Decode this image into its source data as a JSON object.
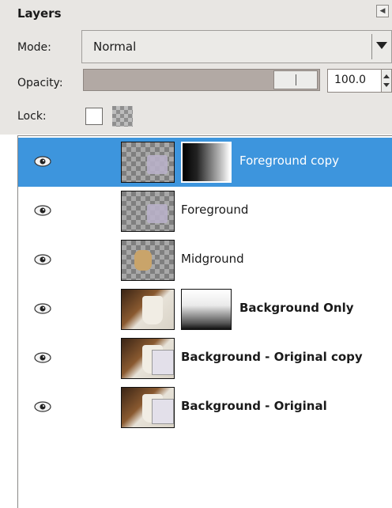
{
  "panel": {
    "title": "Layers",
    "mode_label": "Mode:",
    "mode_value": "Normal",
    "opacity_label": "Opacity:",
    "opacity_value": "100.0",
    "lock_label": "Lock:"
  },
  "layers": [
    {
      "name": "Foreground copy",
      "selected": true,
      "visible": true,
      "has_mask": true,
      "bold": false
    },
    {
      "name": "Foreground",
      "selected": false,
      "visible": true,
      "has_mask": false,
      "bold": false
    },
    {
      "name": "Midground",
      "selected": false,
      "visible": true,
      "has_mask": false,
      "bold": false
    },
    {
      "name": "Background Only",
      "selected": false,
      "visible": true,
      "has_mask": true,
      "bold": true
    },
    {
      "name": "Background - Original copy",
      "selected": false,
      "visible": true,
      "has_mask": false,
      "bold": true
    },
    {
      "name": "Background - Original",
      "selected": false,
      "visible": true,
      "has_mask": false,
      "bold": true
    }
  ],
  "colors": {
    "selection": "#3d95dd",
    "panel_bg": "#e8e6e3"
  },
  "icons": {
    "visibility": "eye-icon",
    "detach": "detach-icon",
    "dropdown": "chevron-down-icon"
  }
}
